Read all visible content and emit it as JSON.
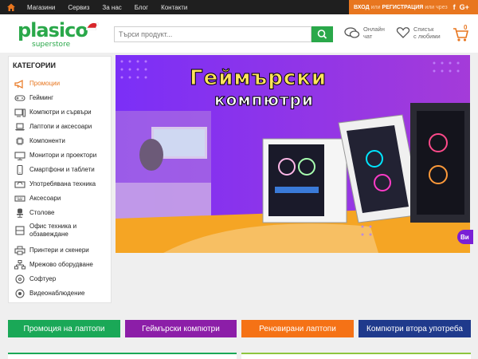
{
  "topnav": {
    "items": [
      "Магазини",
      "Сервиз",
      "За нас",
      "Блог",
      "Контакти"
    ]
  },
  "auth": {
    "login": "ВХОД",
    "or1": "или",
    "register": "РЕГИСТРАЦИЯ",
    "or2": "или чрез",
    "facebook": "f",
    "google": "G+"
  },
  "logo": {
    "main": "plasico",
    "sub": "superstore"
  },
  "search": {
    "placeholder": "Търси продукт..."
  },
  "header": {
    "chat_line1": "Онлайн",
    "chat_line2": "чат",
    "fav_line1": "Списък",
    "fav_line2": "с любими",
    "cart_count": "0"
  },
  "sidebar": {
    "title": "КАТЕГОРИИ",
    "items": [
      {
        "label": "Промоции",
        "icon": "megaphone-icon"
      },
      {
        "label": "Гейминг",
        "icon": "gamepad-icon"
      },
      {
        "label": "Компютри и сървъри",
        "icon": "desktop-icon"
      },
      {
        "label": "Лаптопи и аксесоари",
        "icon": "laptop-icon"
      },
      {
        "label": "Компоненти",
        "icon": "chip-icon"
      },
      {
        "label": "Монитори и проектори",
        "icon": "monitor-icon"
      },
      {
        "label": "Смартфони и таблети",
        "icon": "smartphone-icon"
      },
      {
        "label": "Употребявана техника",
        "icon": "recycle-icon"
      },
      {
        "label": "Аксесоари",
        "icon": "keyboard-icon"
      },
      {
        "label": "Столове",
        "icon": "chair-icon"
      },
      {
        "label": "Офис техника и обзавеждане",
        "icon": "office-icon"
      },
      {
        "label": "Принтери и скенери",
        "icon": "printer-icon"
      },
      {
        "label": "Мрежово оборудване",
        "icon": "network-icon"
      },
      {
        "label": "Софтуер",
        "icon": "disc-icon"
      },
      {
        "label": "Видеонаблюдение",
        "icon": "camera-icon"
      }
    ]
  },
  "banner": {
    "title_line1": "Геймърски",
    "title_line2": "компютри",
    "cta": "Ви"
  },
  "promos": [
    "Промоция на лаптопи",
    "Геймърски компютри",
    "Реновирани лаптопи",
    "Компютри втора употреба"
  ],
  "colors": {
    "brand_green": "#2aa84a",
    "accent_orange": "#e8761f",
    "banner_purple": "#8a2be2",
    "promo_green": "#1aa857",
    "promo_purple": "#8c1ea8",
    "promo_orange": "#f57216",
    "promo_blue": "#1f3a8c"
  }
}
